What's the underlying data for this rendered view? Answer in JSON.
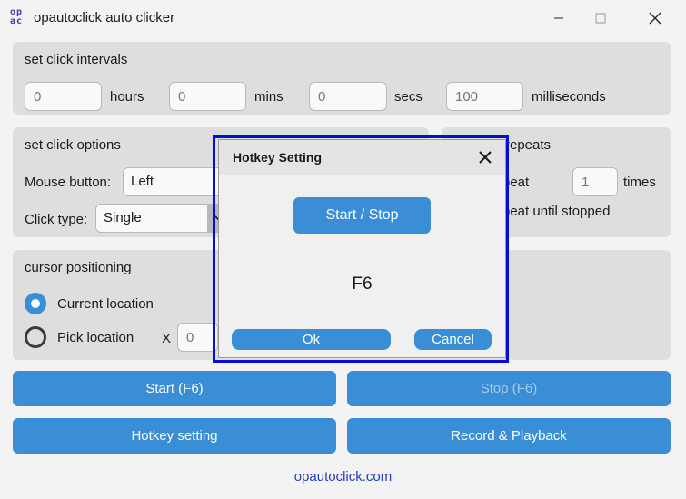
{
  "window": {
    "app_icon_text": [
      "op",
      "ac"
    ],
    "title": "opautoclick auto clicker"
  },
  "intervals": {
    "title": "set click intervals",
    "fields": [
      {
        "value": "0",
        "unit": "hours"
      },
      {
        "value": "0",
        "unit": "mins"
      },
      {
        "value": "0",
        "unit": "secs"
      },
      {
        "value": "100",
        "unit": "milliseconds"
      }
    ]
  },
  "options": {
    "title": "set click options",
    "mouse_button_label": "Mouse button:",
    "mouse_button_value": "Left",
    "click_type_label": "Click type:",
    "click_type_value": "Single"
  },
  "repeats": {
    "title_visible": "repeats",
    "repeat_label_visible": "peat",
    "repeat_value": "1",
    "times_label": "times",
    "until_stopped_visible": "peat until stopped"
  },
  "cursor": {
    "title": "cursor positioning",
    "current_location": "Current location",
    "pick_location": "Pick location",
    "x_label": "X",
    "x_value": "0",
    "current_selected": true
  },
  "buttons": {
    "start": "Start (F6)",
    "stop": "Stop (F6)",
    "hotkey": "Hotkey setting",
    "record": "Record & Playback"
  },
  "footer_link": "opautoclick.com",
  "dialog": {
    "title": "Hotkey Setting",
    "action_button": "Start / Stop",
    "hotkey_value": "F6",
    "ok": "Ok",
    "cancel": "Cancel"
  },
  "colors": {
    "accent": "#3a8ed6",
    "highlight_frame": "#0b0bd6",
    "link": "#1f3fbf"
  }
}
